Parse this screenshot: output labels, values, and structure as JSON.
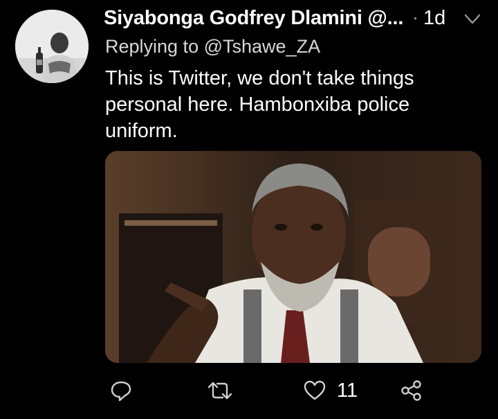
{
  "tweet": {
    "author_name": "Siyabonga Godfrey Dlamini",
    "handle_truncated": "@...",
    "separator": "·",
    "time": "1d",
    "replying_prefix": "Replying to",
    "replying_to": "@Tshawe_ZA",
    "text": "This is Twitter, we don't take things personal here. Hambonxiba police uniform."
  },
  "actions": {
    "reply_icon": "reply-icon",
    "retweet_icon": "retweet-icon",
    "like_icon": "heart-icon",
    "like_count": "11",
    "share_icon": "share-icon"
  },
  "colors": {
    "background": "#000000",
    "text": "#ffffff",
    "secondary": "#d8d8d8",
    "muted": "#9aa0a6"
  }
}
